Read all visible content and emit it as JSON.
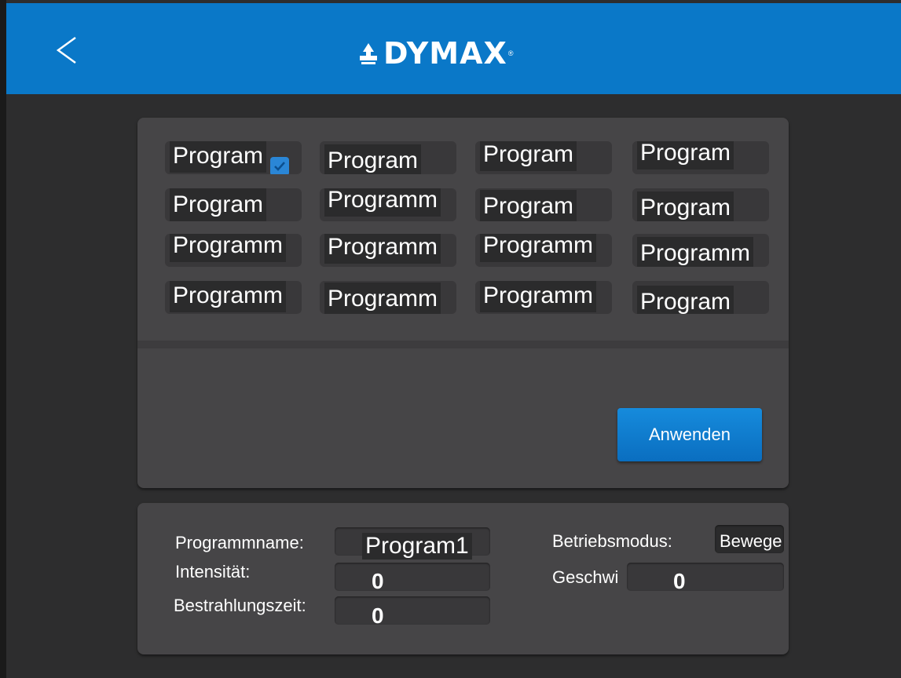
{
  "header": {
    "brand": "DYMAX",
    "brand_reg": "®",
    "accent": "#0a78c8"
  },
  "programs": [
    [
      "Program",
      "Program",
      "Program",
      "Program"
    ],
    [
      "Program",
      "Programm",
      "Program",
      "Program"
    ],
    [
      "Programm",
      "Programm",
      "Programm",
      "Programm"
    ],
    [
      "Programm",
      "Programm",
      "Programm",
      "Program"
    ]
  ],
  "selected_checked": true,
  "apply_label": "Anwenden",
  "details": {
    "name_label": "Programmname:",
    "name_value": "Program1",
    "intensity_label": "Intensität:",
    "intensity_value": "0",
    "exposure_label": "Bestrahlungszeit:",
    "exposure_value": "0",
    "mode_label": "Betriebsmodus:",
    "mode_value": "Bewege",
    "speed_label": "Geschwi",
    "speed_value": "0"
  }
}
